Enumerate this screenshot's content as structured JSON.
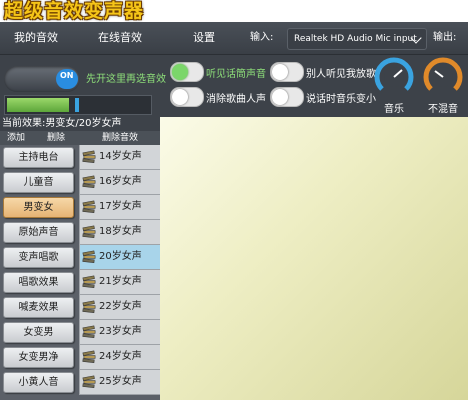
{
  "app": {
    "title": "超级音效变声器"
  },
  "tabs": [
    "我的音效",
    "在线音效",
    "设置"
  ],
  "io": {
    "input_label": "输入:",
    "input_value": "Realtek HD Audio Mic input",
    "output_label": "输出:"
  },
  "controls": {
    "main_toggle_label": "ON",
    "main_toggle_hint": "先开这里再选音效",
    "switches": [
      {
        "label": "听见话筒声音",
        "on": true
      },
      {
        "label": "别人听见我放歌",
        "on": false
      },
      {
        "label": "消除歌曲人声",
        "on": false
      },
      {
        "label": "说话时音乐变小",
        "on": false
      }
    ],
    "gauges": [
      {
        "label": "音乐",
        "color": "#3aa3e0"
      },
      {
        "label": "不混音",
        "color": "#e08a2a"
      }
    ]
  },
  "status": {
    "current_effect": "当前效果:男变女/20岁女声"
  },
  "list_actions": {
    "add": "添加",
    "delete": "删除",
    "delete_effect": "删除音效"
  },
  "categories": [
    "主持电台",
    "儿童音",
    "男变女",
    "原始声音",
    "变声唱歌",
    "唱歌效果",
    "喊麦效果",
    "女变男",
    "女变男净",
    "小黄人音"
  ],
  "presets": [
    "14岁女声",
    "16岁女声",
    "17岁女声",
    "18岁女声",
    "20岁女声",
    "21岁女声",
    "22岁女声",
    "23岁女声",
    "24岁女声",
    "25岁女声"
  ],
  "selection": {
    "category_index": 2,
    "preset_index": 4
  },
  "colors": {
    "accent_green": "#8ee07a",
    "selected_category": "#e6b374",
    "selected_preset": "#a8d4ea",
    "toggle_blue": "#2a8de0"
  }
}
